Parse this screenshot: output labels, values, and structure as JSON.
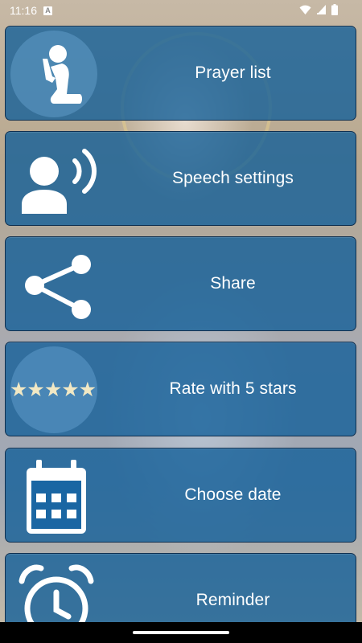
{
  "status_bar": {
    "time": "11:16",
    "notification_glyph": "A",
    "icons": [
      "wifi-icon",
      "signal-icon",
      "battery-icon"
    ]
  },
  "menu": {
    "items": [
      {
        "label": "Prayer list",
        "icon": "praying-person-icon"
      },
      {
        "label": "Speech settings",
        "icon": "speaking-person-icon"
      },
      {
        "label": "Share",
        "icon": "share-icon"
      },
      {
        "label": "Rate with 5 stars",
        "icon": "five-stars-icon",
        "stars": "★★★★★"
      },
      {
        "label": "Choose date",
        "icon": "calendar-icon"
      },
      {
        "label": "Reminder",
        "icon": "alarm-clock-icon"
      }
    ]
  },
  "colors": {
    "card_background": "#105d98",
    "card_border": "#0f2f4f",
    "icon_color": "#ffffff",
    "stars_color": "#f1e8c4"
  }
}
